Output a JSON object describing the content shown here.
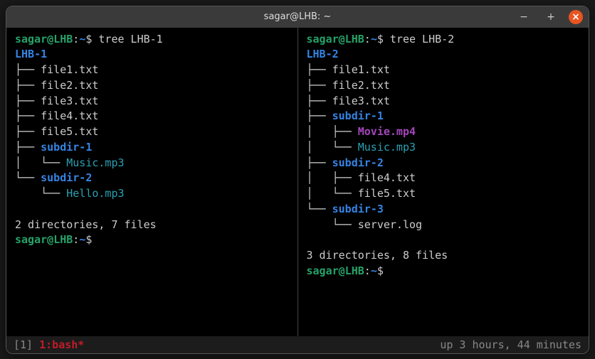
{
  "titlebar": {
    "title": "sagar@LHB: ~",
    "btn_min": "−",
    "btn_max": "+",
    "btn_close": "×"
  },
  "colors": {
    "user_host": "#26a269",
    "path": "#3584e4",
    "dir": "#3584e4",
    "audio": "#2aa1b3",
    "video": "#a347ba",
    "close_btn": "#e95420"
  },
  "prompt": {
    "user": "sagar",
    "at": "@",
    "host": "LHB",
    "colon": ":",
    "path": "~",
    "dollar": "$"
  },
  "left": {
    "command": "tree LHB-1",
    "root": "LHB-1",
    "lines": [
      {
        "branch": "├── ",
        "name": "file1.txt",
        "kind": "file"
      },
      {
        "branch": "├── ",
        "name": "file2.txt",
        "kind": "file"
      },
      {
        "branch": "├── ",
        "name": "file3.txt",
        "kind": "file"
      },
      {
        "branch": "├── ",
        "name": "file4.txt",
        "kind": "file"
      },
      {
        "branch": "├── ",
        "name": "file5.txt",
        "kind": "file"
      },
      {
        "branch": "├── ",
        "name": "subdir-1",
        "kind": "dir"
      },
      {
        "branch": "│   └── ",
        "name": "Music.mp3",
        "kind": "audio"
      },
      {
        "branch": "└── ",
        "name": "subdir-2",
        "kind": "dir"
      },
      {
        "branch": "    └── ",
        "name": "Hello.mp3",
        "kind": "audio"
      }
    ],
    "summary": "2 directories, 7 files"
  },
  "right": {
    "command": "tree LHB-2",
    "root": "LHB-2",
    "lines": [
      {
        "branch": "├── ",
        "name": "file1.txt",
        "kind": "file"
      },
      {
        "branch": "├── ",
        "name": "file2.txt",
        "kind": "file"
      },
      {
        "branch": "├── ",
        "name": "file3.txt",
        "kind": "file"
      },
      {
        "branch": "├── ",
        "name": "subdir-1",
        "kind": "dir"
      },
      {
        "branch": "│   ├── ",
        "name": "Movie.mp4",
        "kind": "video"
      },
      {
        "branch": "│   └── ",
        "name": "Music.mp3",
        "kind": "audio"
      },
      {
        "branch": "├── ",
        "name": "subdir-2",
        "kind": "dir"
      },
      {
        "branch": "│   ├── ",
        "name": "file4.txt",
        "kind": "file"
      },
      {
        "branch": "│   └── ",
        "name": "file5.txt",
        "kind": "file"
      },
      {
        "branch": "└── ",
        "name": "subdir-3",
        "kind": "dir"
      },
      {
        "branch": "    └── ",
        "name": "server.log",
        "kind": "file"
      }
    ],
    "summary": "3 directories, 8 files"
  },
  "statusbar": {
    "left_bracket": "[1] ",
    "session": "1:bash*",
    "right": "up 3 hours, 44 minutes"
  }
}
